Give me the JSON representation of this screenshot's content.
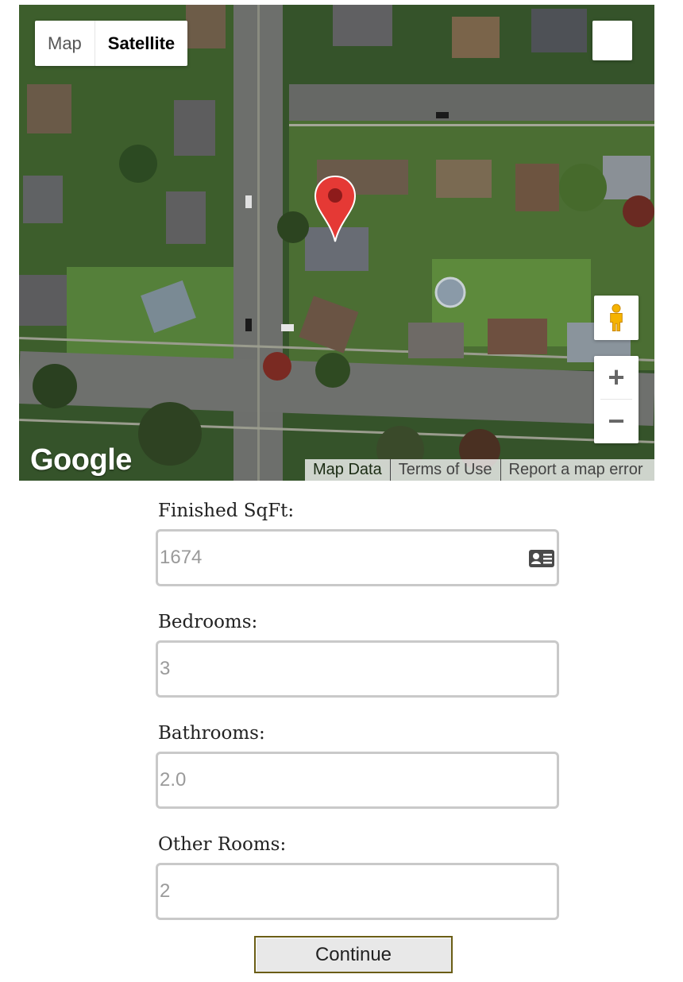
{
  "map": {
    "type_control": {
      "map_label": "Map",
      "satellite_label": "Satellite",
      "selected": "Satellite"
    },
    "logo_text": "Google",
    "attribution": {
      "map_data": "Map Data",
      "terms": "Terms of Use",
      "report": "Report a map error"
    },
    "zoom": {
      "in_label": "+",
      "out_label": "−"
    },
    "marker_color": "#e53935"
  },
  "form": {
    "fields": [
      {
        "label": "Finished SqFt:",
        "value": "1674"
      },
      {
        "label": "Bedrooms:",
        "value": "3"
      },
      {
        "label": "Bathrooms:",
        "value": "2.0"
      },
      {
        "label": "Other Rooms:",
        "value": "2"
      }
    ],
    "continue_label": "Continue"
  }
}
